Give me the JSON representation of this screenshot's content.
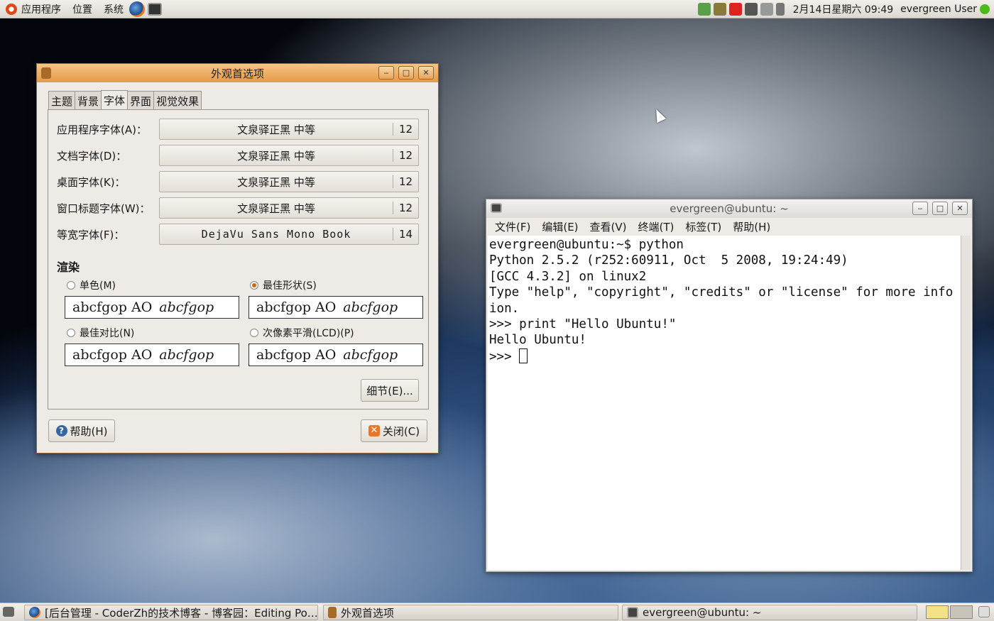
{
  "top_panel": {
    "menus": [
      "应用程序",
      "位置",
      "系统"
    ],
    "clock": "2月14日星期六 09:49",
    "user": "evergreen User"
  },
  "pref_window": {
    "title": "外观首选项",
    "tabs": [
      "主题",
      "背景",
      "字体",
      "界面",
      "视觉效果"
    ],
    "active_tab": "字体",
    "font_rows": [
      {
        "label": "应用程序字体(A)：",
        "font": "文泉驿正黑 中等",
        "size": "12"
      },
      {
        "label": "文档字体(D)：",
        "font": "文泉驿正黑 中等",
        "size": "12"
      },
      {
        "label": "桌面字体(K)：",
        "font": "文泉驿正黑 中等",
        "size": "12"
      },
      {
        "label": "窗口标题字体(W)：",
        "font": "文泉驿正黑 中等",
        "size": "12"
      },
      {
        "label": "等宽字体(F)：",
        "font": "DejaVu Sans Mono Book",
        "size": "14"
      }
    ],
    "render_title": "渲染",
    "render_options": [
      {
        "label": "单色(M)",
        "selected": false
      },
      {
        "label": "最佳形状(S)",
        "selected": true
      },
      {
        "label": "最佳对比(N)",
        "selected": false
      },
      {
        "label": "次像素平滑(LCD)(P)",
        "selected": false
      }
    ],
    "sample_text": "abcfgop AO",
    "sample_italic": "abcfgop",
    "details_button": "细节(E)...",
    "help_button": "帮助(H)",
    "close_button": "关闭(C)"
  },
  "terminal": {
    "title": "evergreen@ubuntu: ~",
    "menus": [
      "文件(F)",
      "编辑(E)",
      "查看(V)",
      "终端(T)",
      "标签(T)",
      "帮助(H)"
    ],
    "lines": [
      "evergreen@ubuntu:~$ python",
      "Python 2.5.2 (r252:60911, Oct  5 2008, 19:24:49)",
      "[GCC 4.3.2] on linux2",
      "Type \"help\", \"copyright\", \"credits\" or \"license\" for more info",
      "ion.",
      ">>> print \"Hello Ubuntu!\"",
      "Hello Ubuntu!"
    ],
    "prompt": ">>> "
  },
  "taskbar": {
    "items": [
      "[后台管理 - CoderZh的技术博客 - 博客园：Editing Po…",
      "外观首选项",
      "evergreen@ubuntu: ~"
    ]
  },
  "colors": {
    "accent": "#e49a48",
    "panel": "#dcd8d1"
  }
}
